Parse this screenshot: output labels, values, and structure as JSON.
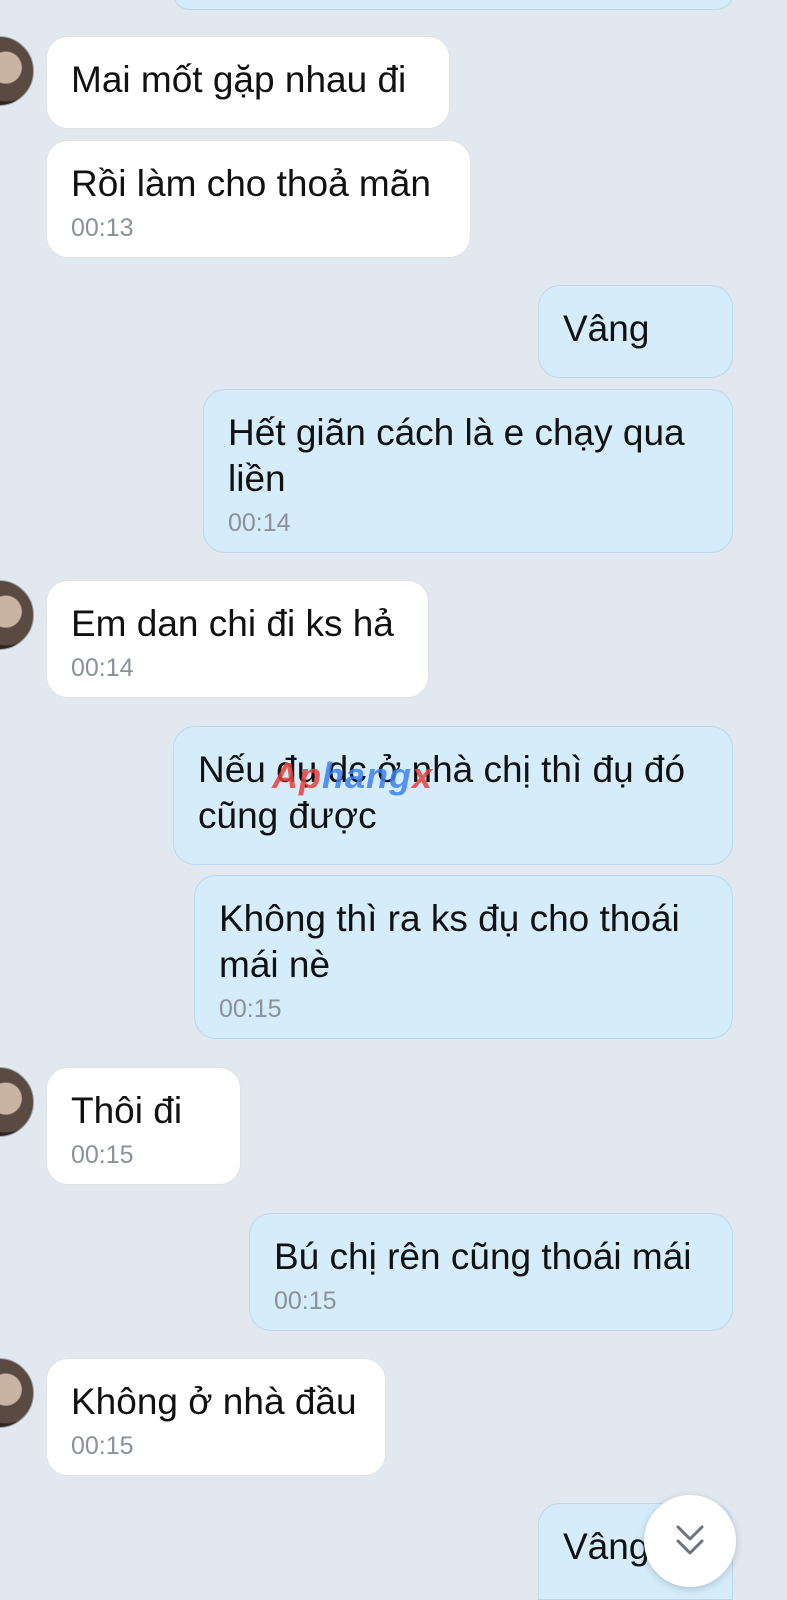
{
  "messages": [
    {
      "id": 1,
      "side": "in",
      "text": "Mai mốt gặp nhau đi",
      "time": ""
    },
    {
      "id": 2,
      "side": "in",
      "text": "Rồi làm cho thoả mãn",
      "time": "00:13"
    },
    {
      "id": 3,
      "side": "out",
      "text": "Vâng",
      "time": ""
    },
    {
      "id": 4,
      "side": "out",
      "text": "Hết giãn cách là e chạy qua liền",
      "time": "00:14"
    },
    {
      "id": 5,
      "side": "in",
      "text": "Em dan chi đi ks hả",
      "time": "00:14"
    },
    {
      "id": 6,
      "side": "out",
      "text": "Nếu đụ dc ở nhà chị thì đụ đó cũng được",
      "time": ""
    },
    {
      "id": 7,
      "side": "out",
      "text": "Không thì ra ks đụ cho thoái mái nè",
      "time": "00:15"
    },
    {
      "id": 8,
      "side": "in",
      "text": "Thôi đi",
      "time": "00:15"
    },
    {
      "id": 9,
      "side": "out",
      "text": "Bú chị rên cũng thoái mái",
      "time": "00:15"
    },
    {
      "id": 10,
      "side": "in",
      "text": "Không ở nhà đầu",
      "time": "00:15"
    },
    {
      "id": 11,
      "side": "out",
      "text": "Vâng",
      "time": ""
    }
  ],
  "watermark": {
    "part1": "Ap",
    "part2": "hang",
    "part3": "x"
  },
  "scroll_button": {
    "icon": "double-chevron-down-icon"
  },
  "colors": {
    "background": "#e2e8f0",
    "incoming_bubble": "#ffffff",
    "outgoing_bubble": "#d5ecfb",
    "timestamp": "#8a9199"
  }
}
